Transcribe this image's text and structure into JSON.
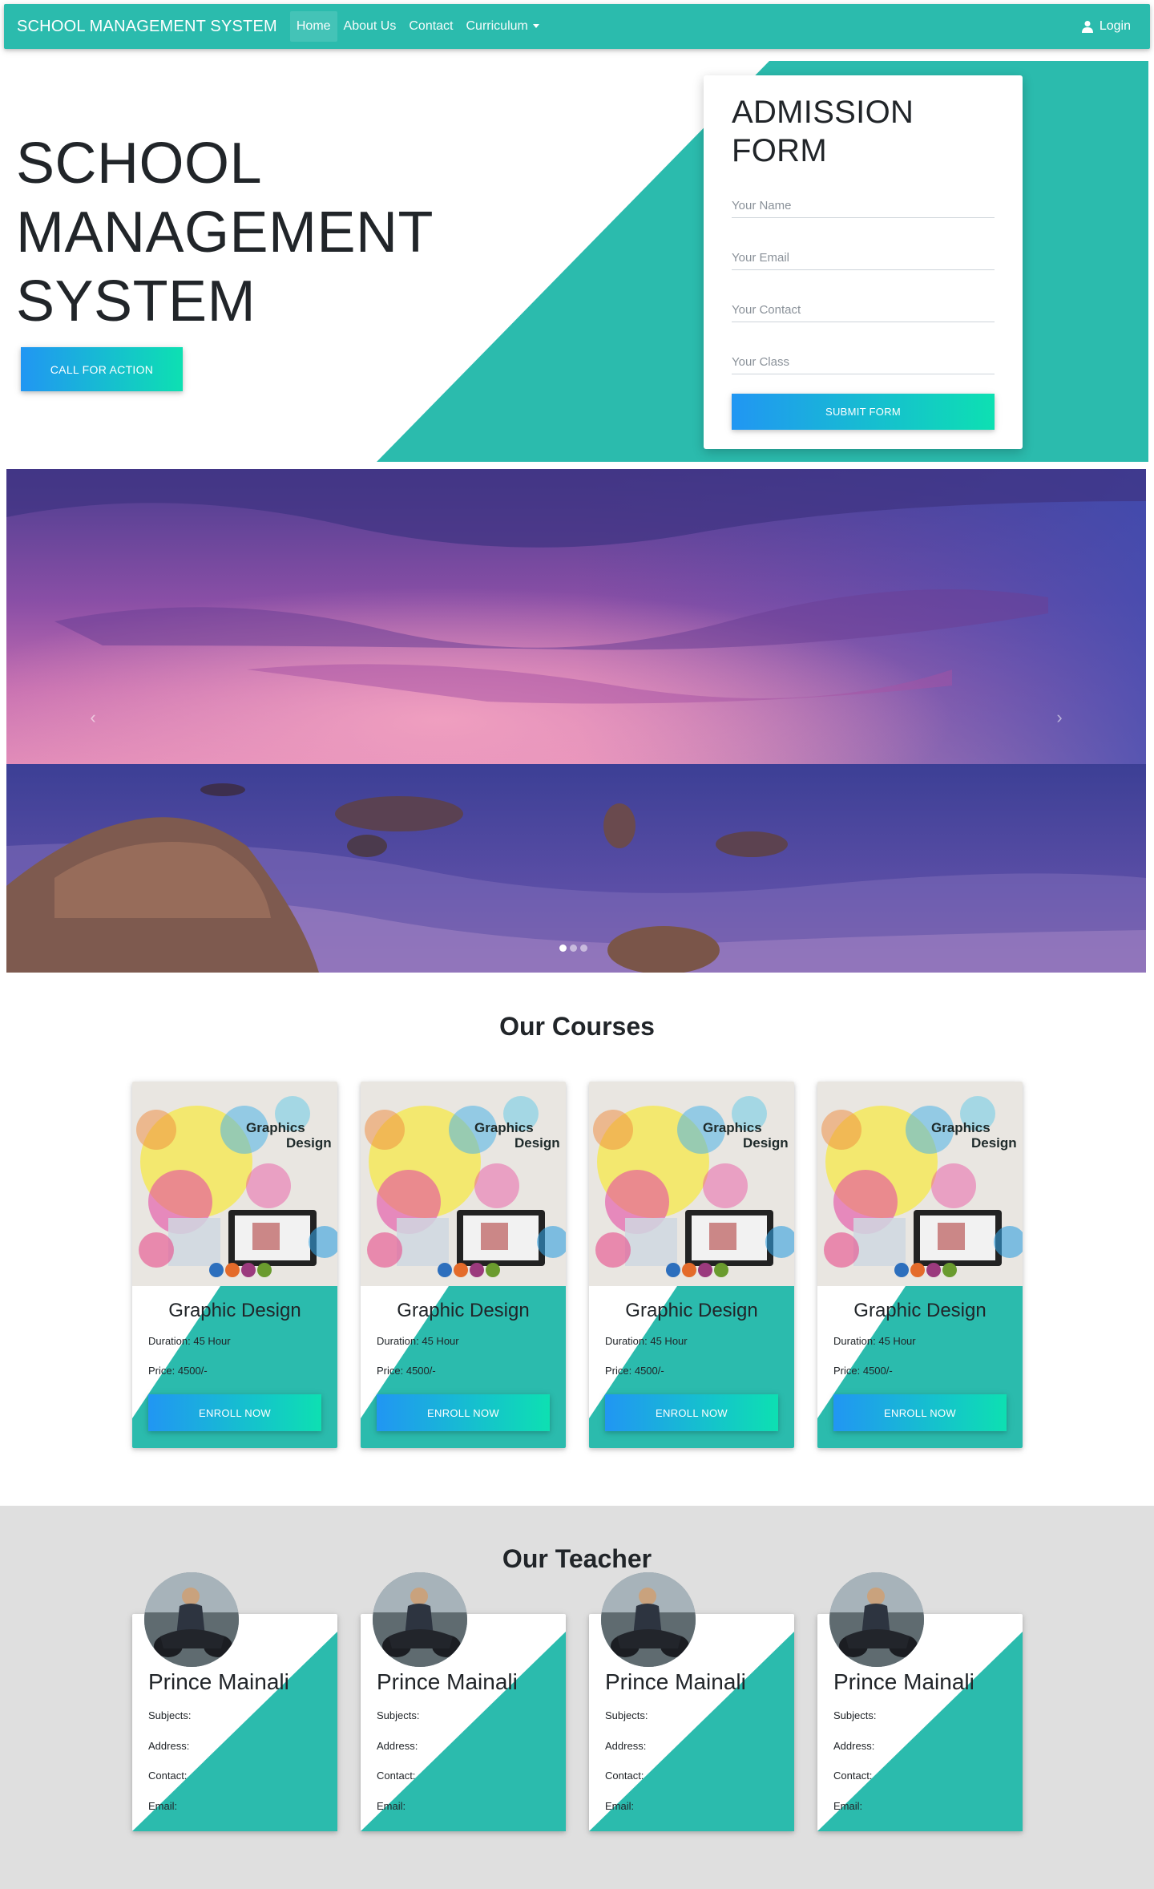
{
  "nav": {
    "brand": "SCHOOL MANAGEMENT SYSTEM",
    "items": [
      {
        "label": "Home",
        "active": true
      },
      {
        "label": "About Us",
        "active": false
      },
      {
        "label": "Contact",
        "active": false
      },
      {
        "label": "Curriculum",
        "active": false,
        "dropdown": true
      }
    ],
    "login_label": "Login",
    "login_icon": "user-icon"
  },
  "hero": {
    "title_lines": [
      "SCHOOL",
      "MANAGEMENT",
      "SYSTEM"
    ],
    "cta_label": "CALL FOR ACTION"
  },
  "admission_form": {
    "title_lines": [
      "ADMISSION",
      "FORM"
    ],
    "fields": [
      {
        "placeholder": "Your Name"
      },
      {
        "placeholder": "Your Email"
      },
      {
        "placeholder": "Your Contact"
      },
      {
        "placeholder": "Your Class"
      }
    ],
    "submit_label": "SUBMIT FORM"
  },
  "carousel": {
    "prev_icon": "chevron-left-icon",
    "next_icon": "chevron-right-icon",
    "slides": 3,
    "active_slide": 1
  },
  "courses": {
    "title": "Our Courses",
    "image_text": [
      "Graphics",
      "Design"
    ],
    "cards": [
      {
        "name": "Graphic Design",
        "duration": "Duration: 45 Hour",
        "price": "Price: 4500/-",
        "button": "ENROLL NOW"
      },
      {
        "name": "Graphic Design",
        "duration": "Duration: 45 Hour",
        "price": "Price: 4500/-",
        "button": "ENROLL NOW"
      },
      {
        "name": "Graphic Design",
        "duration": "Duration: 45 Hour",
        "price": "Price: 4500/-",
        "button": "ENROLL NOW"
      },
      {
        "name": "Graphic Design",
        "duration": "Duration: 45 Hour",
        "price": "Price: 4500/-",
        "button": "ENROLL NOW"
      }
    ]
  },
  "teachers": {
    "title": "Our Teacher",
    "cards": [
      {
        "name": "Prince Mainali",
        "subjects": "Subjects:",
        "address": "Address:",
        "contact": "Contact:",
        "email": "Email:"
      },
      {
        "name": "Prince Mainali",
        "subjects": "Subjects:",
        "address": "Address:",
        "contact": "Contact:",
        "email": "Email:"
      },
      {
        "name": "Prince Mainali",
        "subjects": "Subjects:",
        "address": "Address:",
        "contact": "Contact:",
        "email": "Email:"
      },
      {
        "name": "Prince Mainali",
        "subjects": "Subjects:",
        "address": "Address:",
        "contact": "Contact:",
        "email": "Email:"
      }
    ]
  },
  "colors": {
    "primary": "#2bbbad",
    "gradient_start": "#2196f3",
    "gradient_end": "#0de0b2",
    "teacher_section_bg": "#dfdfdf"
  }
}
